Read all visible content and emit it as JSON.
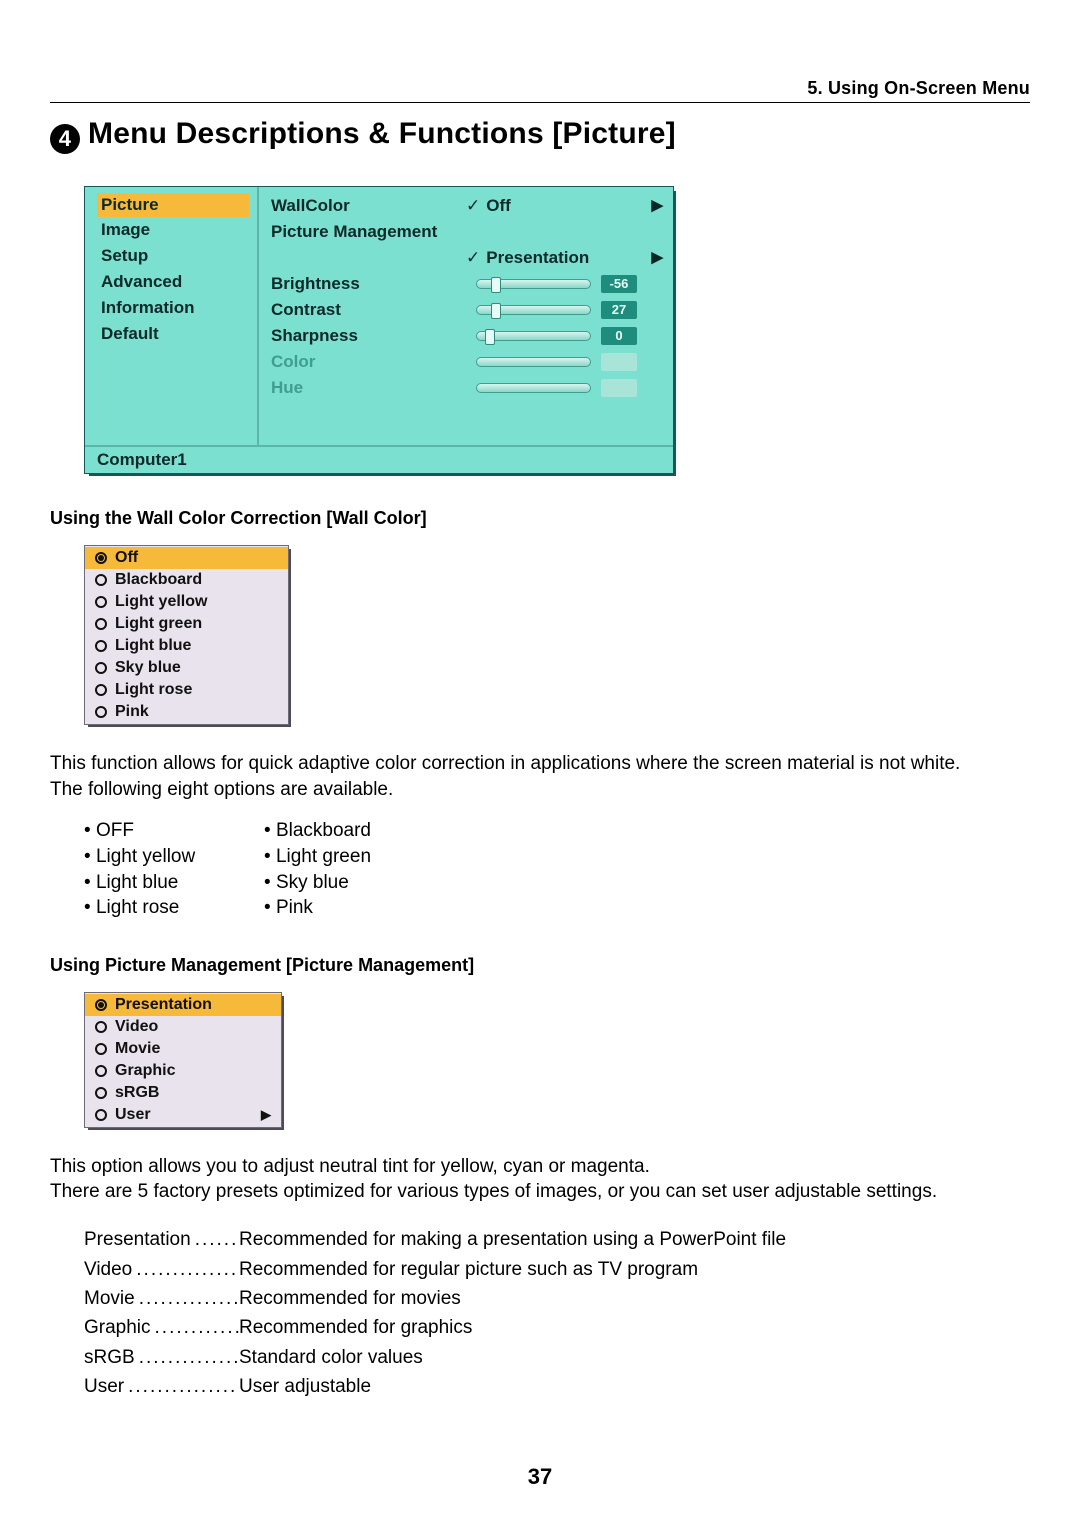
{
  "header": {
    "section": "5. Using On-Screen Menu"
  },
  "title": {
    "num": "4",
    "text": "Menu Descriptions & Functions [Picture]"
  },
  "picture_panel": {
    "sidebar": [
      "Picture",
      "Image",
      "Setup",
      "Advanced",
      "Information",
      "Default"
    ],
    "sidebar_selected": 0,
    "rows": {
      "wallcolor": {
        "label": "WallColor",
        "value": "Off",
        "tick": true,
        "arrow": true
      },
      "pictmgmt": {
        "label": "Picture Management"
      },
      "pictmgmt2": {
        "value": "Presentation",
        "tick": true,
        "arrow": true
      },
      "brightness": {
        "label": "Brightness",
        "num": "-56",
        "thumb": 14
      },
      "contrast": {
        "label": "Contrast",
        "num": "27",
        "thumb": 14
      },
      "sharpness": {
        "label": "Sharpness",
        "num": "0",
        "thumb": 8
      },
      "color": {
        "label": "Color"
      },
      "hue": {
        "label": "Hue"
      }
    },
    "footer": "Computer1"
  },
  "h2_wall": "Using the Wall Color Correction [Wall Color]",
  "wall_options": [
    "Off",
    "Blackboard",
    "Light yellow",
    "Light green",
    "Light blue",
    "Sky blue",
    "Light rose",
    "Pink"
  ],
  "wall_para1": "This function allows for quick adaptive color correction in applications where the screen material is not white.",
  "wall_para2": "The following eight options are available.",
  "wall_bullets": [
    [
      "OFF",
      "Blackboard"
    ],
    [
      "Light yellow",
      "Light green"
    ],
    [
      "Light blue",
      "Sky blue"
    ],
    [
      "Light rose",
      "Pink"
    ]
  ],
  "h2_pict": "Using Picture Management [Picture Management]",
  "pict_options": [
    "Presentation",
    "Video",
    "Movie",
    "Graphic",
    "sRGB",
    "User"
  ],
  "pict_arrow_last": true,
  "pict_para1": "This option allows you to adjust neutral tint for yellow, cyan or magenta.",
  "pict_para2": "There are 5 factory presets optimized for various types of images, or you can set user adjustable settings.",
  "pict_defs": [
    [
      "Presentation",
      "Recommended for making a presentation using a PowerPoint file"
    ],
    [
      "Video",
      "Recommended for regular picture such as TV program"
    ],
    [
      "Movie",
      "Recommended for movies"
    ],
    [
      "Graphic",
      "Recommended for graphics"
    ],
    [
      "sRGB",
      "Standard color values"
    ],
    [
      "User",
      "User adjustable"
    ]
  ],
  "page_number": "37"
}
